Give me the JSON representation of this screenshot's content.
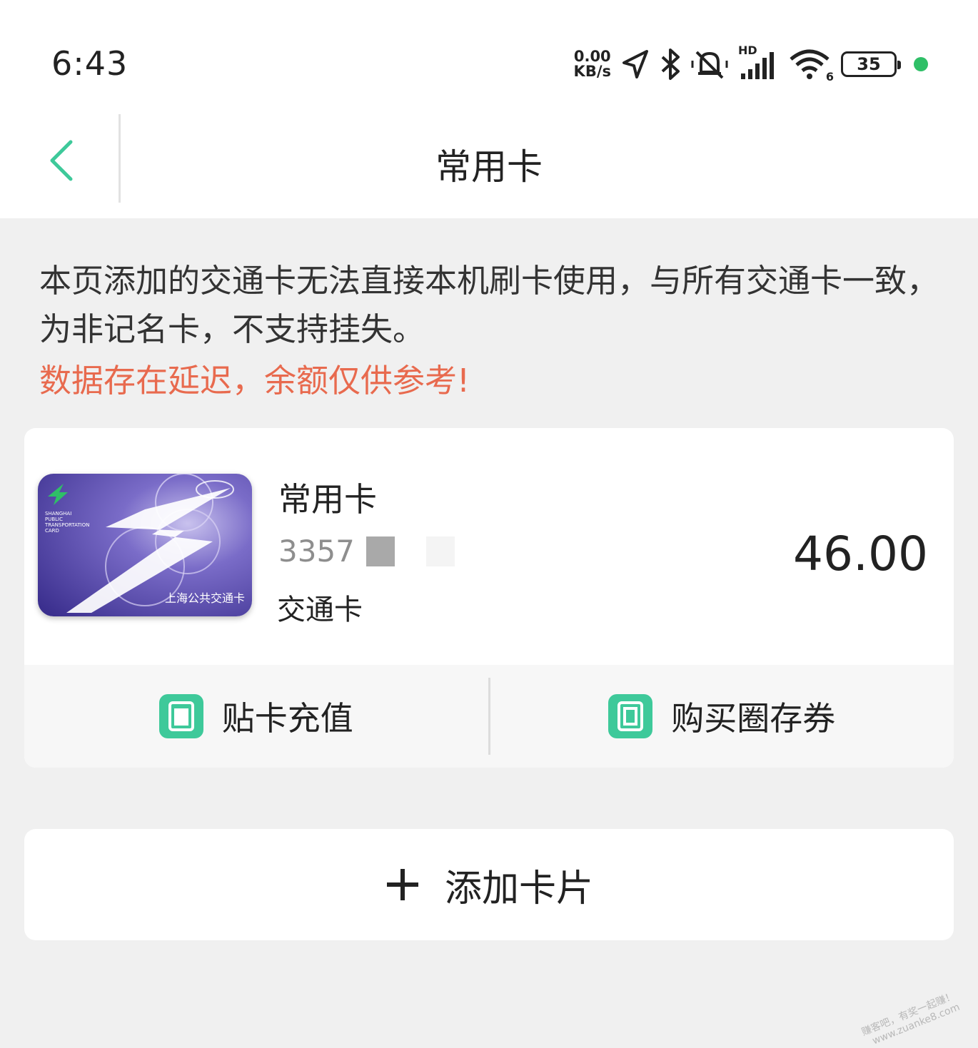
{
  "status_bar": {
    "time": "6:43",
    "net_speed_value": "0.00",
    "net_speed_unit": "KB/s",
    "network_label": "HD",
    "wifi_label": "6",
    "battery": "35",
    "icons": [
      "location-icon",
      "bluetooth-icon",
      "mute-icon",
      "cellular-signal-icon",
      "wifi-icon",
      "battery-icon"
    ]
  },
  "header": {
    "title": "常用卡"
  },
  "notice": {
    "text": "本页添加的交通卡无法直接本机刷卡使用，与所有交通卡一致，为非记名卡，不支持挂失。",
    "warning": "数据存在延迟，余额仅供参考!"
  },
  "card": {
    "name": "常用卡",
    "number_prefix": "3357",
    "type": "交通卡",
    "balance": "46.00",
    "image_label": "上海公共交通卡",
    "image_text_top": "SHANGHAI PUBLIC TRANSPORTATION CARD",
    "actions": [
      {
        "label": "贴卡充值",
        "icon": "recharge-card-icon"
      },
      {
        "label": "购买圈存券",
        "icon": "voucher-icon"
      }
    ]
  },
  "add_card": {
    "label": "添加卡片",
    "icon": "plus-icon"
  },
  "watermark": {
    "line1": "赚客吧，有奖一起赚！",
    "line2": "www.zuanke8.com"
  },
  "colors": {
    "accent_green": "#3ec99a",
    "warning_red": "#e86a4e",
    "card_purple": "#4b3fa0"
  }
}
